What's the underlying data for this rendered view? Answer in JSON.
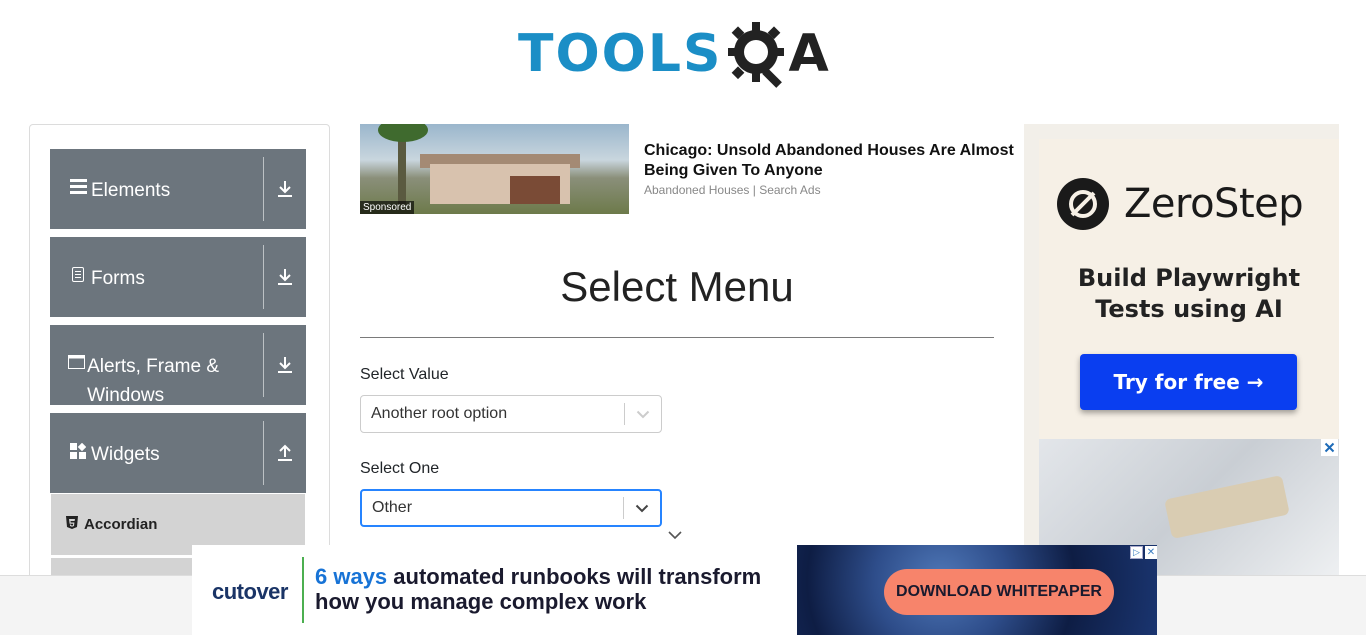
{
  "logo": {
    "text": "TOOLS",
    "suffix": "A"
  },
  "sidebar": {
    "groups": [
      {
        "label": "Elements",
        "icon": "menu-icon",
        "toggle": "download-arrow-icon"
      },
      {
        "label": "Forms",
        "icon": "document-icon",
        "toggle": "download-arrow-icon"
      },
      {
        "label": "Alerts, Frame & Windows",
        "icon": "window-icon",
        "toggle": "download-arrow-icon"
      },
      {
        "label": "Widgets",
        "icon": "widgets-icon",
        "toggle": "upload-arrow-icon"
      }
    ],
    "submenu": [
      {
        "label": "Accordian",
        "icon": "html5-icon"
      }
    ]
  },
  "sponsored_ad": {
    "badge": "Sponsored",
    "headline": "Chicago: Unsold Abandoned Houses Are Almost Being Given To Anyone",
    "source": "Abandoned Houses | Search Ads"
  },
  "main": {
    "title": "Select Menu",
    "select_value": {
      "label": "Select Value",
      "value": "Another root option"
    },
    "select_one": {
      "label": "Select One",
      "value": "Other"
    }
  },
  "right_ad": {
    "brand": "ZeroStep",
    "tagline_line1": "Build Playwright",
    "tagline_line2": "Tests using AI",
    "cta": "Try for free →",
    "close": "✕"
  },
  "bottom_ad": {
    "logo": "cutover",
    "text_accent": "6 ways",
    "text_rest": " automated runbooks will transform how you manage complex work",
    "cta": "DOWNLOAD WHITEPAPER",
    "adchoices": "▷",
    "close": "✕"
  },
  "colors": {
    "brand_blue": "#1b8ec6",
    "sidebar_group": "#6c757d",
    "submenu_bg": "#d3d3d3",
    "focus_blue": "#2684ff",
    "zerostep_button": "#0a3ef0",
    "cutover_accent": "#1773d6",
    "banner_cta": "#f7846b"
  }
}
